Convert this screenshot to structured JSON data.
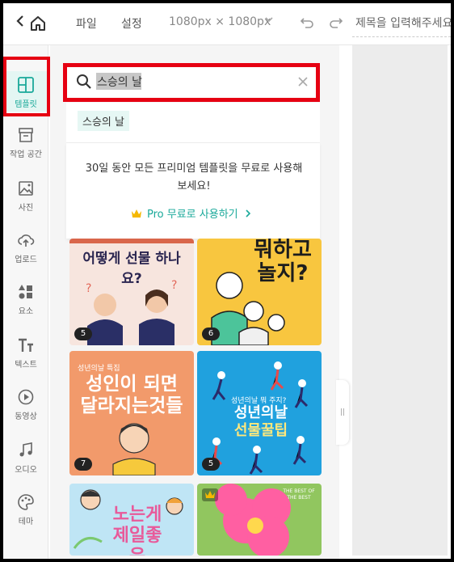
{
  "topbar": {
    "menu_file": "파일",
    "menu_settings": "설정",
    "canvas_size": "1080px × 1080px",
    "title_placeholder": "제목을 입력해주세요."
  },
  "sidebar": {
    "items": [
      {
        "label": "템플릿",
        "icon": "template-icon"
      },
      {
        "label": "작업 공간",
        "icon": "workspace-icon"
      },
      {
        "label": "사진",
        "icon": "photo-icon"
      },
      {
        "label": "업로드",
        "icon": "upload-icon"
      },
      {
        "label": "요소",
        "icon": "elements-icon"
      },
      {
        "label": "텍스트",
        "icon": "text-icon"
      },
      {
        "label": "동영상",
        "icon": "video-icon"
      },
      {
        "label": "오디오",
        "icon": "audio-icon"
      },
      {
        "label": "테마",
        "icon": "theme-icon"
      }
    ]
  },
  "search": {
    "value": "스승의 날",
    "suggestion": "스승의 날"
  },
  "promo": {
    "text": "30일 동안 모든 프리미엄 템플릿을 무료로 사용해 보세요!",
    "link": "Pro 무료로 사용하기"
  },
  "templates": [
    {
      "title": "어떻게 선물 하나요?",
      "count": "5"
    },
    {
      "title": "뭐하고 놀지?",
      "count": "6"
    },
    {
      "subtitle": "성년의날 특집",
      "title": "성인이 되면 달라지는것들",
      "count": "7"
    },
    {
      "subtitle": "성년의날 뭐 주지?",
      "title_line1": "성년의날",
      "title_line2": "선물꿀팁",
      "count": "5"
    },
    {
      "title": "노는게 제일좋은"
    },
    {
      "subtitle": "THE BEST OF THE BEST"
    }
  ],
  "colors": {
    "accent": "#1aa99a",
    "highlight_frame": "#e60012"
  }
}
